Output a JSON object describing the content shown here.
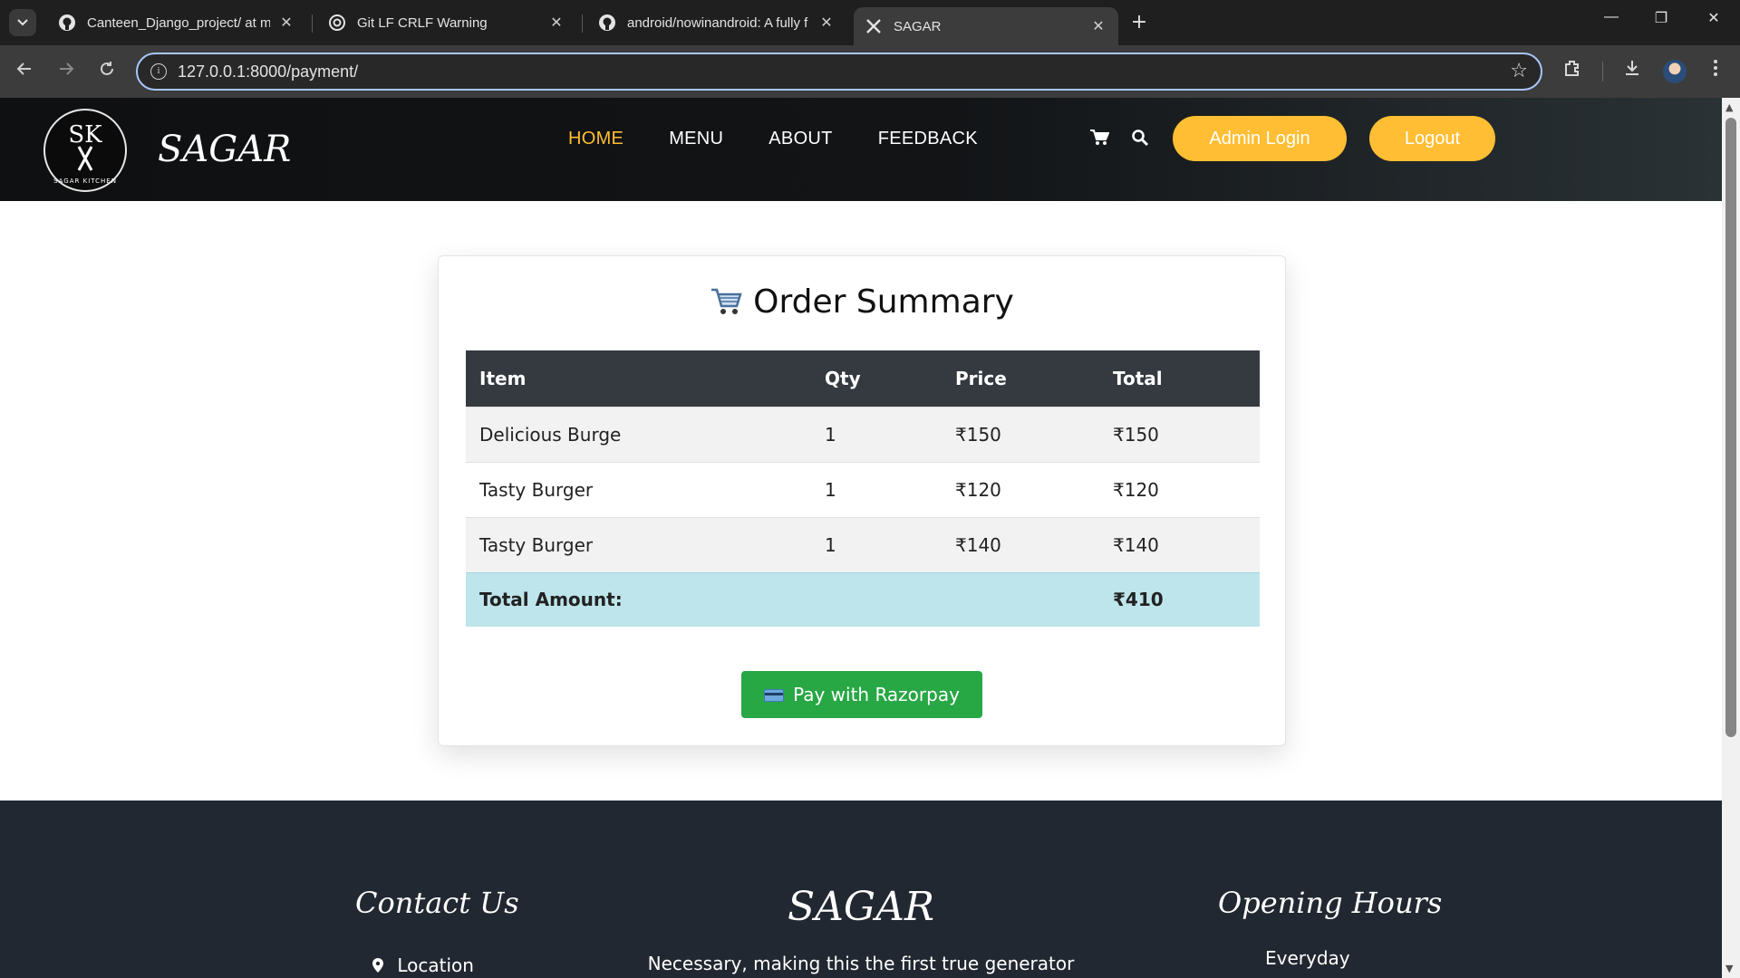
{
  "browser": {
    "tabs": [
      {
        "title": "Canteen_Django_project/ at ma",
        "icon": "github-icon"
      },
      {
        "title": "Git LF CRLF Warning",
        "icon": "openai-icon"
      },
      {
        "title": "android/nowinandroid: A fully f",
        "icon": "github-icon"
      },
      {
        "title": "SAGAR",
        "icon": "cutlery-icon"
      }
    ],
    "url": "127.0.0.1:8000/payment/"
  },
  "header": {
    "logo_text": "SK",
    "logo_ring_text": "SAGAR KITCHEN",
    "brand": "SAGAR",
    "nav": [
      "HOME",
      "MENU",
      "ABOUT",
      "FEEDBACK"
    ],
    "active_nav": "HOME",
    "admin_login": "Admin Login",
    "logout": "Logout"
  },
  "order": {
    "title": "Order Summary",
    "columns": [
      "Item",
      "Qty",
      "Price",
      "Total"
    ],
    "rows": [
      {
        "item": "Delicious Burge",
        "qty": "1",
        "price": "₹150",
        "total": "₹150"
      },
      {
        "item": "Tasty Burger",
        "qty": "1",
        "price": "₹120",
        "total": "₹120"
      },
      {
        "item": "Tasty Burger",
        "qty": "1",
        "price": "₹140",
        "total": "₹140"
      }
    ],
    "total_label": "Total Amount:",
    "total_value": "₹410",
    "pay_button": "Pay with Razorpay"
  },
  "footer": {
    "contact_title": "Contact Us",
    "location": "Location",
    "brand": "SAGAR",
    "tagline": "Necessary, making this the first true generator",
    "hours_title": "Opening Hours",
    "hours_text": "Everyday"
  },
  "colors": {
    "accent": "#ffbe33",
    "table_header": "#343a40",
    "total_row": "#bee5eb",
    "pay_button": "#28a745",
    "footer_bg": "#222831"
  }
}
